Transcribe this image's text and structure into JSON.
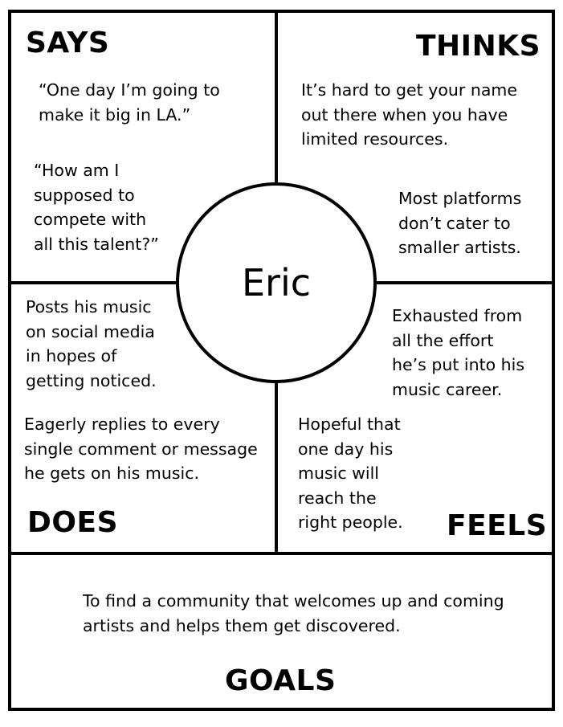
{
  "persona": {
    "name": "Eric"
  },
  "says": {
    "heading": "SAYS",
    "quote_1": "“One day I’m going to\nmake it big in LA.”",
    "quote_2": "“How am I\nsupposed to\ncompete with\nall this talent?”"
  },
  "thinks": {
    "heading": "THINKS",
    "thought_1": "It’s hard to get your name\nout there when you have\nlimited resources.",
    "thought_2": "Most platforms\ndon’t cater to\nsmaller artists."
  },
  "does": {
    "heading": "DOES",
    "action_1": "Posts his music\non social media\nin hopes of\ngetting noticed.",
    "action_2": "Eagerly replies to every\nsingle comment or message\nhe gets on his music."
  },
  "feels": {
    "heading": "FEELS",
    "feeling_1": "Exhausted from\nall the effort\nhe’s put into his\nmusic career.",
    "feeling_2": "Hopeful that\none day his\nmusic will\nreach the\nright people."
  },
  "goals": {
    "heading": "GOALS",
    "text": "To find a community that welcomes up and coming\nartists and helps them get discovered."
  }
}
